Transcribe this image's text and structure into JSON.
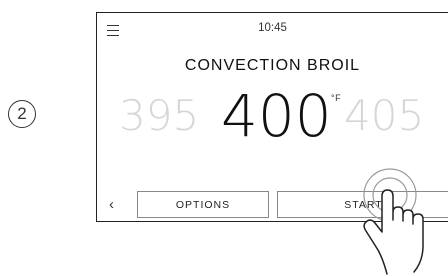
{
  "step": {
    "number": "2"
  },
  "screen": {
    "time": "10:45",
    "mode": "CONVECTION BROIL",
    "temperature": {
      "previous": "395",
      "current": "400",
      "next": "405",
      "unit": "°F"
    },
    "buttons": {
      "options_label": "OPTIONS",
      "start_label": "START"
    }
  },
  "icons": {
    "menu": "menu-icon",
    "back": "chevron-left-icon",
    "hand": "hand-pointer-icon"
  }
}
